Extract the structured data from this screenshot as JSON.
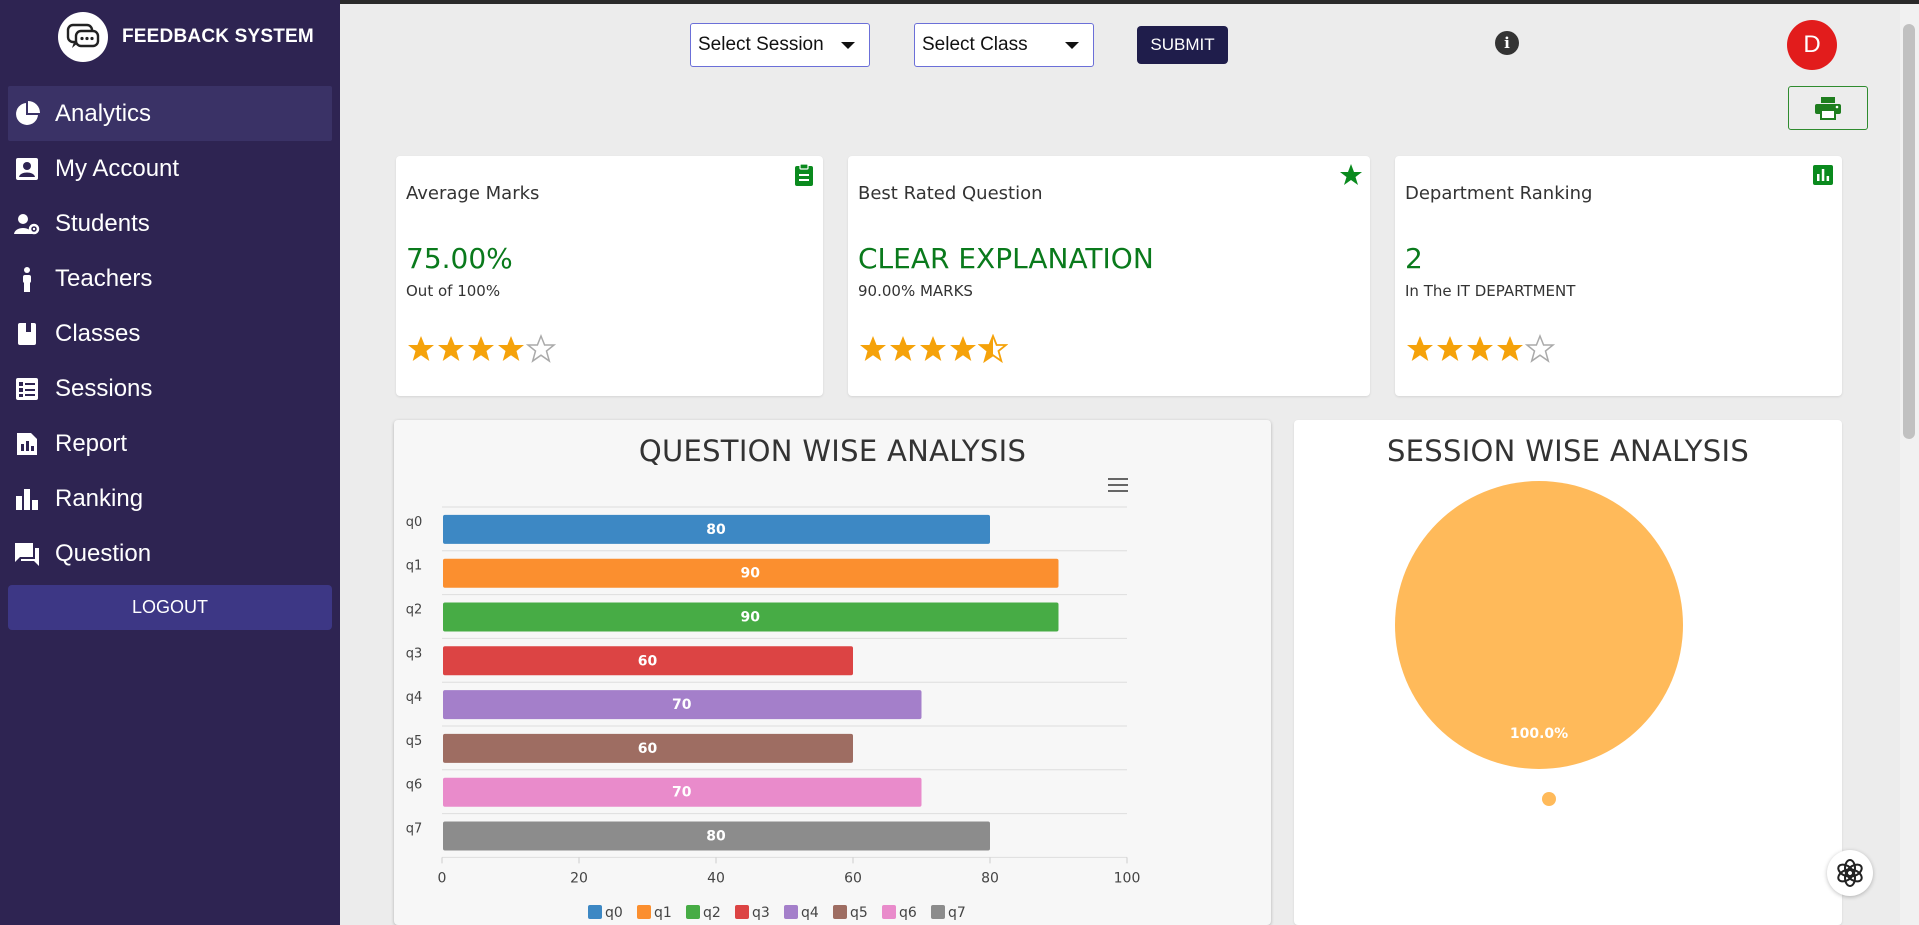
{
  "brand": {
    "title": "FEEDBACK SYSTEM"
  },
  "nav": [
    {
      "label": "Analytics",
      "icon": "pie-chart-icon",
      "active": true
    },
    {
      "label": "My Account",
      "icon": "account-icon",
      "active": false
    },
    {
      "label": "Students",
      "icon": "students-icon",
      "active": false
    },
    {
      "label": "Teachers",
      "icon": "teacher-icon",
      "active": false
    },
    {
      "label": "Classes",
      "icon": "book-icon",
      "active": false
    },
    {
      "label": "Sessions",
      "icon": "list-icon",
      "active": false
    },
    {
      "label": "Report",
      "icon": "report-icon",
      "active": false
    },
    {
      "label": "Ranking",
      "icon": "bar-chart-icon",
      "active": false
    },
    {
      "label": "Question",
      "icon": "forum-icon",
      "active": false
    }
  ],
  "logout_label": "LOGOUT",
  "toolbar": {
    "session_select": "Select Session",
    "class_select": "Select Class",
    "submit_label": "SUBMIT",
    "avatar_letter": "D"
  },
  "cards": [
    {
      "title": "Average Marks",
      "value": "75.00%",
      "sub": "Out of 100%",
      "rating": 4,
      "icon": "clipboard-icon"
    },
    {
      "title": "Best Rated Question",
      "value": "CLEAR EXPLANATION",
      "sub": "90.00% MARKS",
      "rating": 4.5,
      "icon": "star-icon"
    },
    {
      "title": "Department Ranking",
      "value": "2",
      "sub": "In The IT DEPARTMENT",
      "rating": 4,
      "icon": "poll-icon"
    }
  ],
  "colors": {
    "accent_green": "#0a7a1c",
    "star": "#f5a20a",
    "sidebar": "#2e2452"
  },
  "chart_data": [
    {
      "type": "bar",
      "orientation": "horizontal",
      "title": "QUESTION WISE ANALYSIS",
      "categories": [
        "q0",
        "q1",
        "q2",
        "q3",
        "q4",
        "q5",
        "q6",
        "q7"
      ],
      "values": [
        80,
        90,
        90,
        60,
        70,
        60,
        70,
        80
      ],
      "colors": [
        "#3d88c4",
        "#fb8f2f",
        "#47ac45",
        "#dc4444",
        "#a47fca",
        "#9e6d62",
        "#e98bcb",
        "#8c8c8c"
      ],
      "xlim": [
        0,
        100
      ],
      "xticks": [
        0,
        20,
        40,
        60,
        80,
        100
      ],
      "legend": "bottom",
      "data_labels": true
    },
    {
      "type": "pie",
      "title": "SESSION WISE ANALYSIS",
      "slices": [
        {
          "value": 100.0,
          "label": "100.0%",
          "color": "#ffba5a"
        }
      ],
      "legend": "bottom"
    }
  ]
}
